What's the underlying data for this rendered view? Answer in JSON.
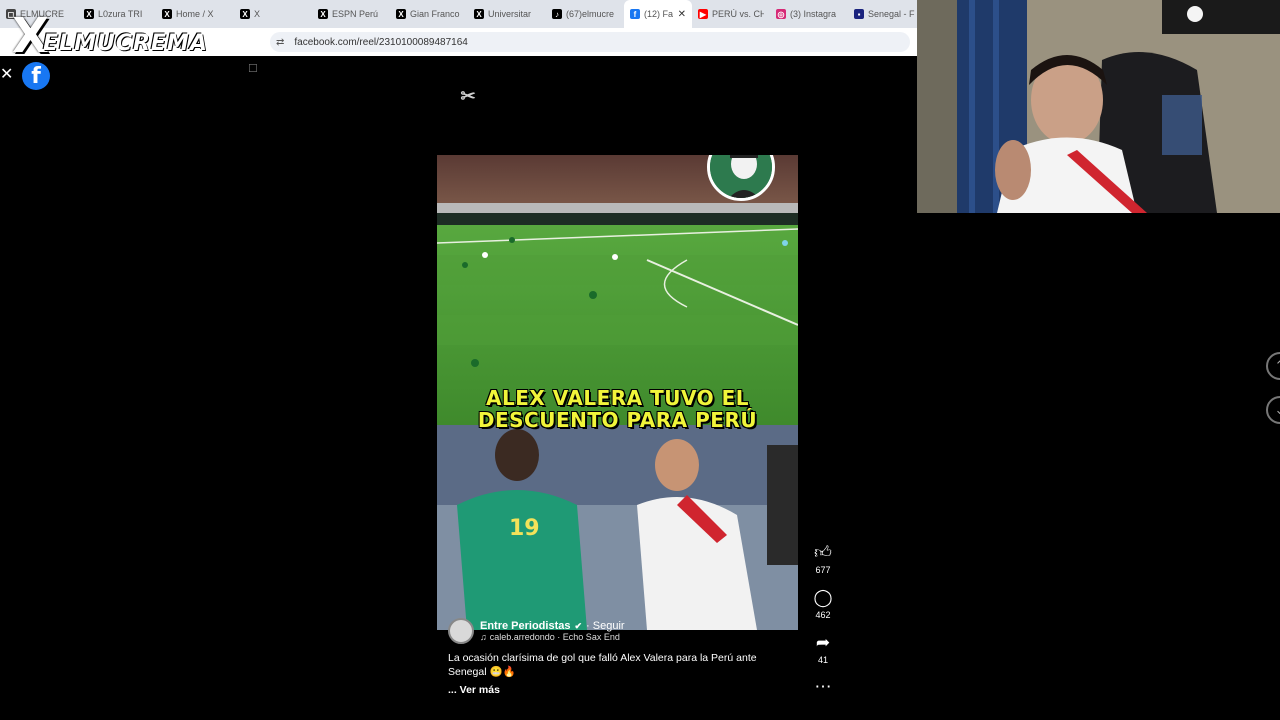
{
  "browser": {
    "tabs": [
      {
        "label": "ELMUCRE",
        "icon": "page-icon",
        "color": "#444444"
      },
      {
        "label": "L0zura TRI",
        "icon": "x-logo-icon",
        "color": "#000000"
      },
      {
        "label": "Home / X",
        "icon": "x-logo-icon",
        "color": "#000000"
      },
      {
        "label": "X",
        "icon": "x-logo-icon",
        "color": "#000000"
      },
      {
        "label": "ESPN Perú",
        "icon": "x-logo-icon",
        "color": "#000000"
      },
      {
        "label": "Gian Franco",
        "icon": "x-logo-icon",
        "color": "#000000"
      },
      {
        "label": "Universitar",
        "icon": "x-logo-icon",
        "color": "#000000"
      },
      {
        "label": "(67)elmucre",
        "icon": "tiktok-icon",
        "color": "#000000"
      },
      {
        "label": "(12) Fa",
        "icon": "facebook-icon",
        "color": "#1877f2",
        "active": true
      },
      {
        "label": "PERÚ vs. CH",
        "icon": "youtube-icon",
        "color": "#ff0000"
      },
      {
        "label": "(3) Instagra",
        "icon": "instagram-icon",
        "color": "#d62976"
      },
      {
        "label": "Senegal - F",
        "icon": "news-icon",
        "color": "#1a237e"
      }
    ],
    "url": "facebook.com/reel/2310100089487164"
  },
  "overlay": {
    "logo_x": "X",
    "logo_text": "ELMUCREMA"
  },
  "reel": {
    "caption_line1": "ALEX VALERA TUVO EL",
    "caption_line2": "DESCUENTO PARA PERÚ",
    "author": "Entre Periodistas",
    "follow": "· Seguir",
    "music": "caleb.arredondo · Echo Sax End",
    "description": "La ocasión clarísima de gol que falló Alex Valera para la Perú ante Senegal 😬🔥",
    "more": "... Ver más",
    "likes": "677",
    "comments": "462",
    "shares": "41"
  },
  "colors": {
    "facebook_blue": "#1877f2",
    "caption_yellow": "#f1f53a"
  }
}
